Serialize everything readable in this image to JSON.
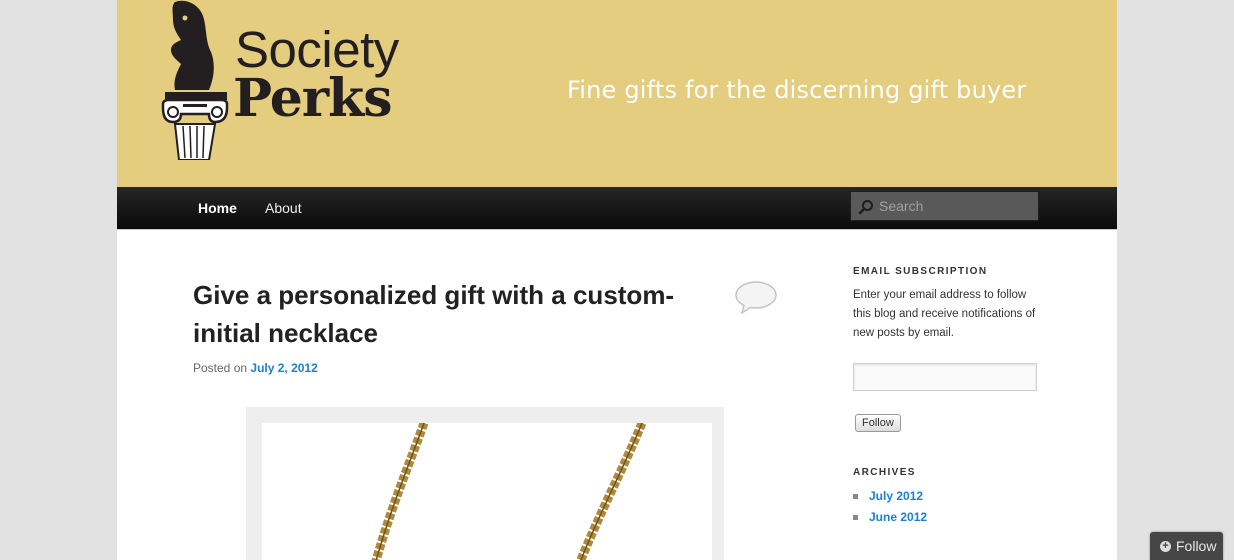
{
  "header": {
    "logo": {
      "line1": "Society",
      "line2": "Perks"
    },
    "tagline": "Fine gifts for the discerning gift buyer"
  },
  "nav": {
    "items": [
      {
        "label": "Home"
      },
      {
        "label": "About"
      }
    ],
    "search": {
      "placeholder": "Search"
    }
  },
  "post": {
    "title": "Give a personalized gift with a custom-initial necklace",
    "meta_prefix": "Posted on",
    "date": "July 2, 2012"
  },
  "sidebar": {
    "subscription": {
      "title": "EMAIL SUBSCRIPTION",
      "description": "Enter your email address to follow this blog and receive notifications of new posts by email.",
      "email_value": "",
      "button_label": "Follow"
    },
    "archives": {
      "title": "ARCHIVES",
      "items": [
        {
          "label": "July 2012"
        },
        {
          "label": "June 2012"
        }
      ]
    }
  },
  "follow_bar": {
    "label": "Follow"
  },
  "colors": {
    "header_bg": "#e4cd7f",
    "link": "#1982d1",
    "nav_bg": "#111111",
    "page_bg": "#e2e2e2"
  },
  "icons": [
    "chess-knight-column-logo",
    "search-icon",
    "comment-bubble-icon",
    "plus-circle-icon"
  ]
}
